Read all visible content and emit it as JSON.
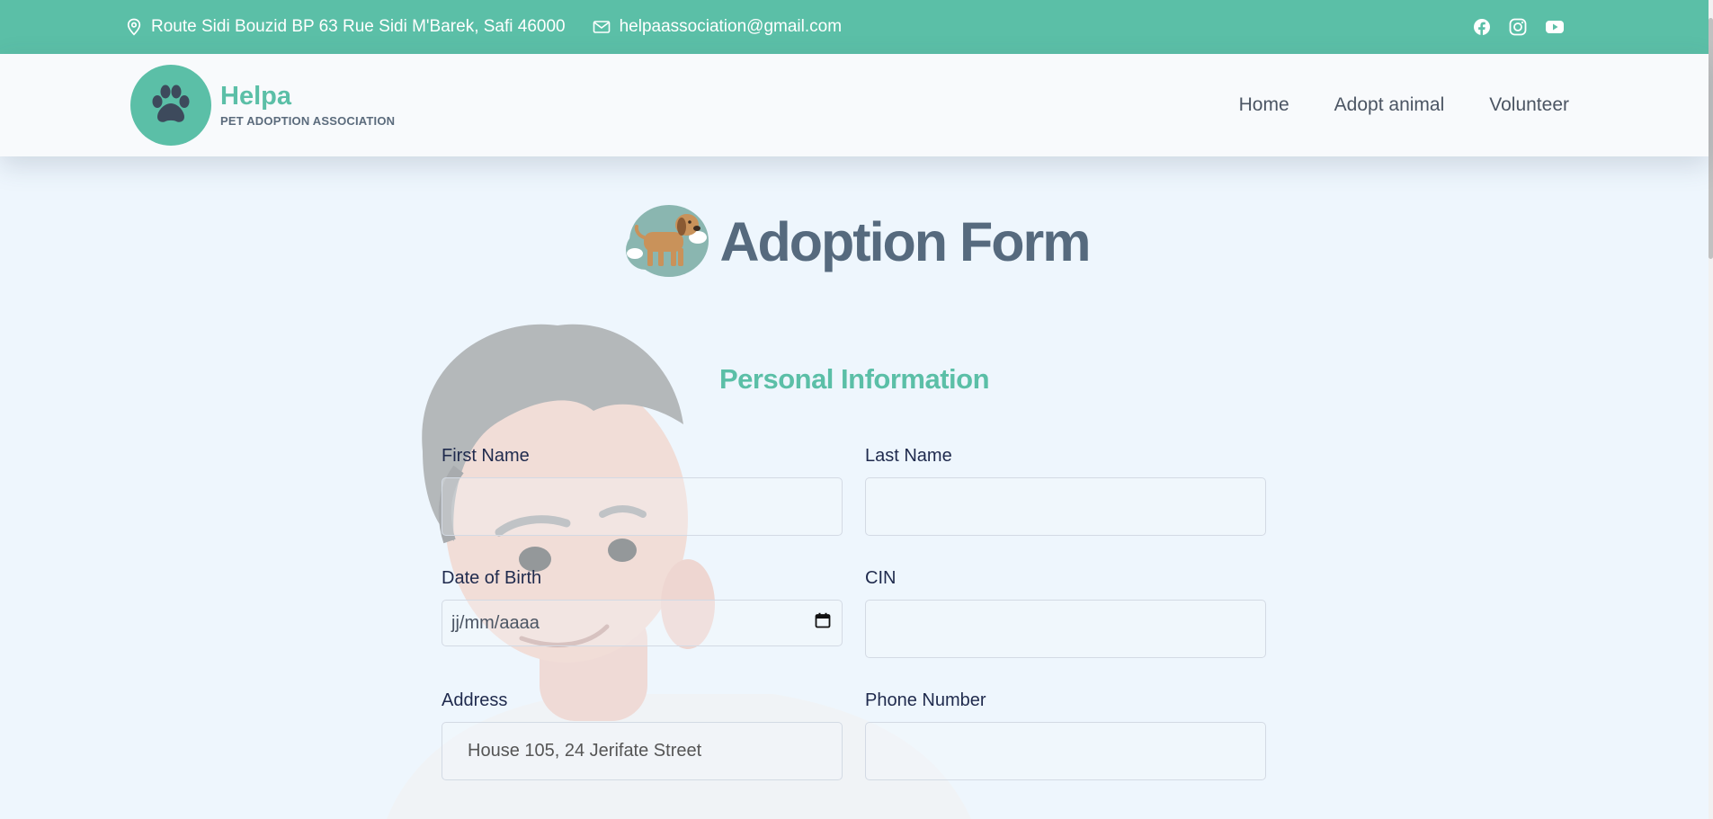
{
  "topbar": {
    "address": "Route Sidi Bouzid BP 63 Rue Sidi M'Barek, Safi 46000",
    "email": "helpaassociation@gmail.com",
    "socials": [
      "facebook-icon",
      "instagram-icon",
      "youtube-icon"
    ]
  },
  "brand": {
    "name": "Helpa",
    "tagline": "PET ADOPTION ASSOCIATION"
  },
  "nav": {
    "items": [
      {
        "label": "Home"
      },
      {
        "label": "Adopt animal"
      },
      {
        "label": "Volunteer"
      }
    ]
  },
  "page": {
    "title": "Adoption Form",
    "section_title": "Personal Information"
  },
  "form": {
    "first_name": {
      "label": "First Name",
      "value": ""
    },
    "last_name": {
      "label": "Last Name",
      "value": ""
    },
    "dob": {
      "label": "Date of Birth",
      "placeholder": "jj/mm/aaaa"
    },
    "cin": {
      "label": "CIN",
      "value": ""
    },
    "address": {
      "label": "Address",
      "placeholder": "House 105, 24 Jerifate Street"
    },
    "phone": {
      "label": "Phone Number",
      "value": ""
    }
  },
  "colors": {
    "accent": "#5bbfa7",
    "title": "#566a7e",
    "background": "#eef6fd"
  }
}
